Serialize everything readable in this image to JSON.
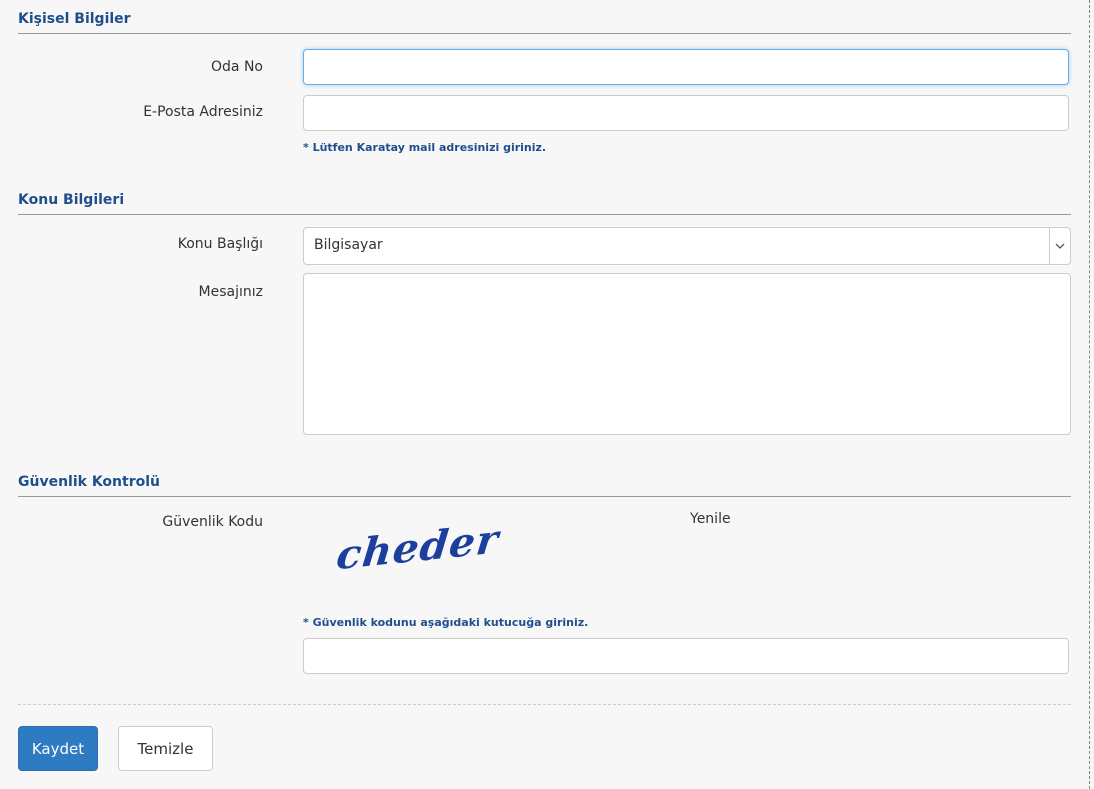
{
  "sections": {
    "personal": "Kişisel Bilgiler",
    "topic": "Konu Bilgileri",
    "security": "Güvenlik Kontrolü"
  },
  "fields": {
    "room_label": "Oda No",
    "room_value": "",
    "email_label": "E-Posta Adresiniz",
    "email_value": "",
    "email_hint": "* Lütfen Karatay mail adresinizi giriniz.",
    "subject_label": "Konu Başlığı",
    "subject_value": "Bilgisayar",
    "message_label": "Mesajınız",
    "message_value": "",
    "captcha_label": "Güvenlik Kodu",
    "captcha_image_text": "cheder",
    "refresh_label": "Yenile",
    "captcha_hint": "* Güvenlik kodunu aşağıdaki kutucuğa giriniz.",
    "captcha_value": ""
  },
  "buttons": {
    "save": "Kaydet",
    "clear": "Temizle"
  },
  "colors": {
    "accent": "#1f4e8c",
    "primary_button": "#2f7bc3",
    "focus_border": "#66afe9"
  },
  "icons": {
    "select_arrow": "chevron-down-icon"
  }
}
